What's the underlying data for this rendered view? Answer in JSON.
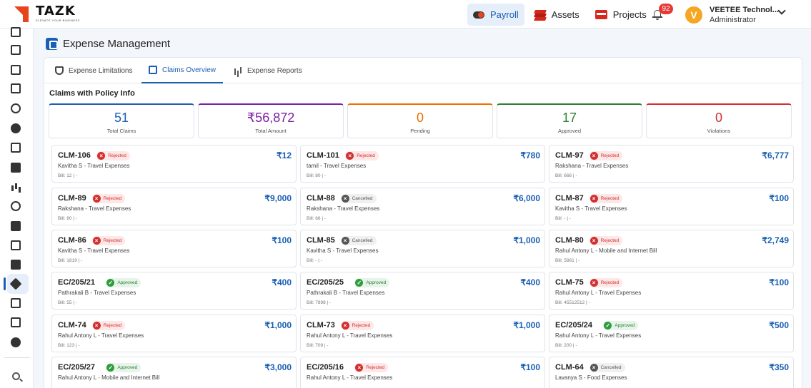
{
  "brand": {
    "name": "TAZK",
    "tagline": "ELEVATE YOUR BUSINESS"
  },
  "topnav": [
    {
      "label": "Payroll",
      "icon": "toggle-icon",
      "active": true
    },
    {
      "label": "Assets",
      "icon": "stack-icon",
      "active": false
    },
    {
      "label": "Projects",
      "icon": "projects-icon",
      "active": false
    }
  ],
  "notifications": {
    "count": "92"
  },
  "user": {
    "initial": "V",
    "name": "VEETEE Technol...",
    "role": "Administrator"
  },
  "page": {
    "title": "Expense Management"
  },
  "tabs": [
    {
      "label": "Expense Limitations",
      "icon": "shield-icon"
    },
    {
      "label": "Claims Overview",
      "icon": "document-icon",
      "active": true
    },
    {
      "label": "Expense Reports",
      "icon": "chart-icon"
    }
  ],
  "section_title": "Claims with Policy Info",
  "stats": [
    {
      "value": "51",
      "label": "Total Claims",
      "color": "#1a5fb4"
    },
    {
      "value": "₹56,872",
      "label": "Total Amount",
      "color": "#7b1fa2"
    },
    {
      "value": "0",
      "label": "Pending",
      "color": "#ef6c00"
    },
    {
      "value": "17",
      "label": "Approved",
      "color": "#2e7d32"
    },
    {
      "value": "0",
      "label": "Violations",
      "color": "#d32f2f"
    }
  ],
  "claims": [
    {
      "id": "CLM-106",
      "status": "Rejected",
      "amount": "₹12",
      "desc": "Kavitha S - Travel Expenses",
      "bill": "Bill: 12 | -"
    },
    {
      "id": "CLM-101",
      "status": "Rejected",
      "amount": "₹780",
      "desc": "tamil - Travel Expenses",
      "bill": "Bill: 80 | -"
    },
    {
      "id": "CLM-97",
      "status": "Rejected",
      "amount": "₹6,777",
      "desc": "Rakshana - Travel Expenses",
      "bill": "Bill: 666 | -"
    },
    {
      "id": "CLM-89",
      "status": "Rejected",
      "amount": "₹9,000",
      "desc": "Rakshana - Travel Expenses",
      "bill": "Bill: 80 | -"
    },
    {
      "id": "CLM-88",
      "status": "Cancelled",
      "amount": "₹6,000",
      "desc": "Rakshana - Travel Expenses",
      "bill": "Bill: 66 | -"
    },
    {
      "id": "CLM-87",
      "status": "Rejected",
      "amount": "₹100",
      "desc": "Kavitha S - Travel Expenses",
      "bill": "Bill: - | -"
    },
    {
      "id": "CLM-86",
      "status": "Rejected",
      "amount": "₹100",
      "desc": "Kavitha S - Travel Expenses",
      "bill": "Bill: 1819 | -"
    },
    {
      "id": "CLM-85",
      "status": "Cancelled",
      "amount": "₹1,000",
      "desc": "Kavitha S - Travel Expenses",
      "bill": "Bill: - | -"
    },
    {
      "id": "CLM-80",
      "status": "Rejected",
      "amount": "₹2,749",
      "desc": "Rahul Antony L - Mobile and Internet Bill",
      "bill": "Bill: 5861 | -"
    },
    {
      "id": "EC/205/21",
      "status": "Approved",
      "amount": "₹400",
      "desc": "Pathrakali B - Travel Expenses",
      "bill": "Bill: 55 | -"
    },
    {
      "id": "EC/205/25",
      "status": "Approved",
      "amount": "₹400",
      "desc": "Pathrakali B - Travel Expenses",
      "bill": "Bill: 7898 | -"
    },
    {
      "id": "CLM-75",
      "status": "Rejected",
      "amount": "₹100",
      "desc": "Rahul Antony L - Travel Expenses",
      "bill": "Bill: 45512512 | -"
    },
    {
      "id": "CLM-74",
      "status": "Rejected",
      "amount": "₹1,000",
      "desc": "Rahul Antony L - Travel Expenses",
      "bill": "Bill: 123 | -"
    },
    {
      "id": "CLM-73",
      "status": "Rejected",
      "amount": "₹1,000",
      "desc": "Rahul Antony L - Travel Expenses",
      "bill": "Bill: 709 | -"
    },
    {
      "id": "EC/205/24",
      "status": "Approved",
      "amount": "₹500",
      "desc": "Rahul Antony L - Travel Expenses",
      "bill": "Bill: 200 | -"
    },
    {
      "id": "EC/205/27",
      "status": "Approved",
      "amount": "₹3,000",
      "desc": "Rahul Antony L - Mobile and Internet Bill",
      "bill": ""
    },
    {
      "id": "EC/205/16",
      "status": "Rejected",
      "amount": "₹100",
      "desc": "Rahul Antony L - Travel Expenses",
      "bill": ""
    },
    {
      "id": "CLM-64",
      "status": "Cancelled",
      "amount": "₹350",
      "desc": "Lavanya S - Food Expenses",
      "bill": ""
    }
  ]
}
